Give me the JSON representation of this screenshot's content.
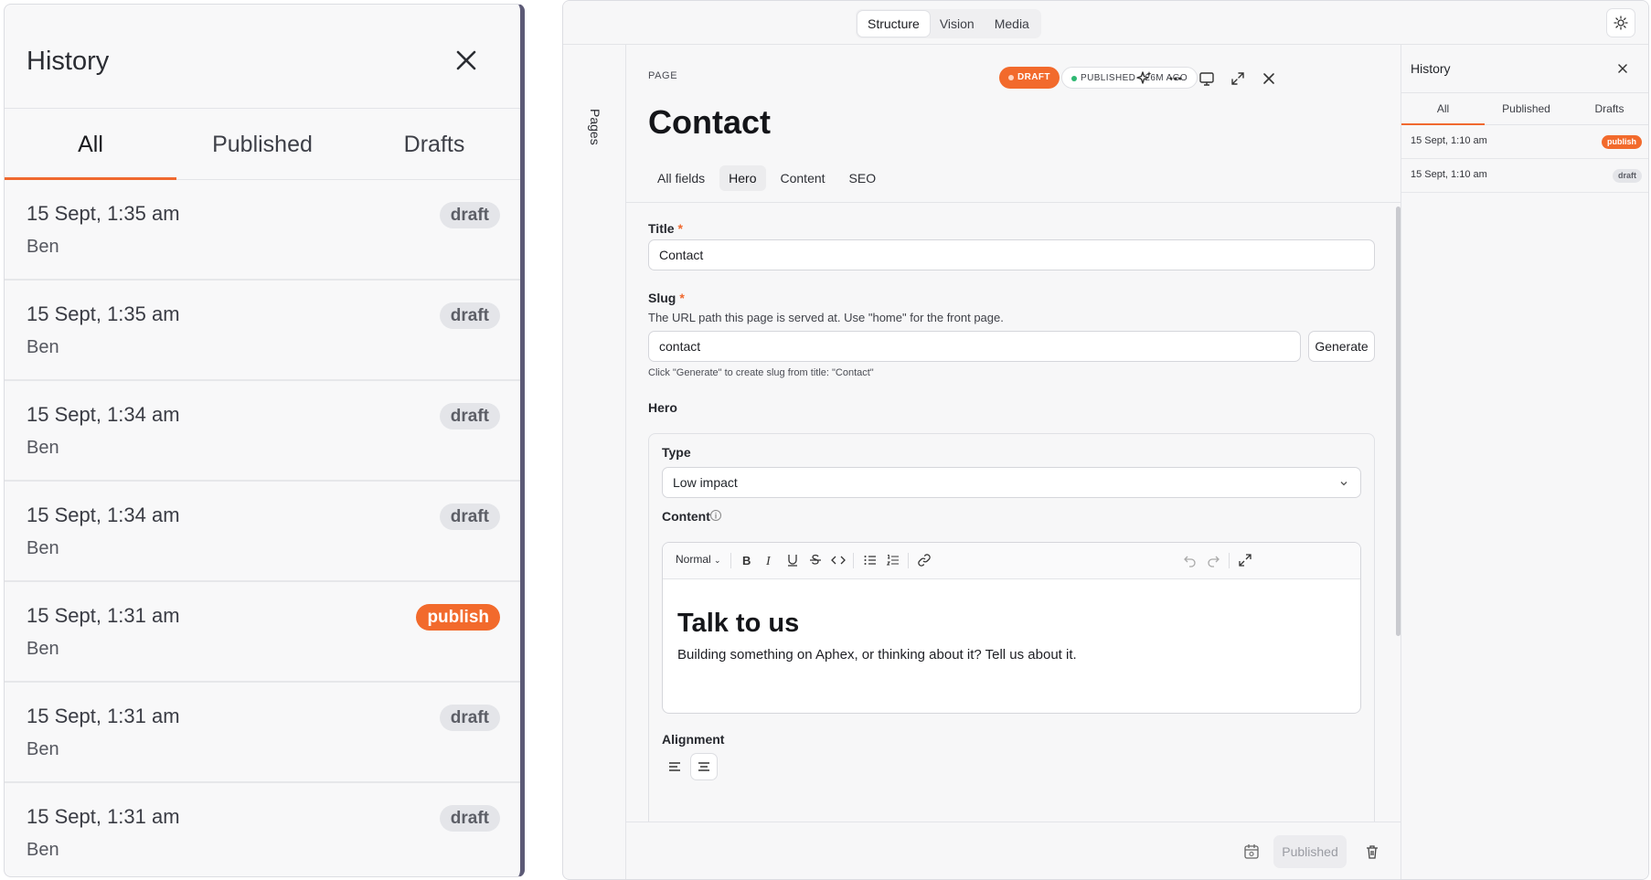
{
  "zoom_panel": {
    "title": "History",
    "tabs": [
      "All",
      "Published",
      "Drafts"
    ],
    "rows": [
      {
        "date": "15 Sept, 1:35 am",
        "user": "Ben",
        "badge": "draft"
      },
      {
        "date": "15 Sept, 1:35 am",
        "user": "Ben",
        "badge": "draft"
      },
      {
        "date": "15 Sept, 1:34 am",
        "user": "Ben",
        "badge": "draft"
      },
      {
        "date": "15 Sept, 1:34 am",
        "user": "Ben",
        "badge": "draft"
      },
      {
        "date": "15 Sept, 1:31 am",
        "user": "Ben",
        "badge": "publish"
      },
      {
        "date": "15 Sept, 1:31 am",
        "user": "Ben",
        "badge": "draft"
      },
      {
        "date": "15 Sept, 1:31 am",
        "user": "Ben",
        "badge": "draft"
      }
    ]
  },
  "topnav": {
    "items": [
      "Structure",
      "Vision",
      "Media"
    ],
    "active": "Structure"
  },
  "rail": {
    "label": "Pages"
  },
  "document": {
    "kicker": "PAGE",
    "title": "Contact",
    "status_draft": "DRAFT",
    "status_published": "PUBLISHED · 26M AGO",
    "tabs": [
      "All fields",
      "Hero",
      "Content",
      "SEO"
    ],
    "active_tab": "Hero"
  },
  "fields": {
    "title_label": "Title",
    "title_value": "Contact",
    "slug_label": "Slug",
    "slug_desc": "The URL path this page is served at. Use \"home\" for the front page.",
    "slug_value": "contact",
    "generate_label": "Generate",
    "slug_hint": "Click \"Generate\" to create slug from title: \"Contact\"",
    "hero_label": "Hero",
    "type_label": "Type",
    "type_value": "Low impact",
    "content_label": "Content",
    "rte_style": "Normal",
    "rte_heading": "Talk to us",
    "rte_paragraph": "Building something on Aphex, or thinking about it? Tell us about it.",
    "alignment_label": "Alignment"
  },
  "footer": {
    "publish_label": "Published"
  },
  "history": {
    "title": "History",
    "tabs": [
      "All",
      "Published",
      "Drafts"
    ],
    "rows": [
      {
        "date": "15 Sept, 1:10 am",
        "badge": "publish"
      },
      {
        "date": "15 Sept, 1:10 am",
        "badge": "draft"
      }
    ]
  },
  "colors": {
    "accent": "#f26a2c",
    "published_dot": "#2eb872",
    "frame": "#5c5a76"
  }
}
